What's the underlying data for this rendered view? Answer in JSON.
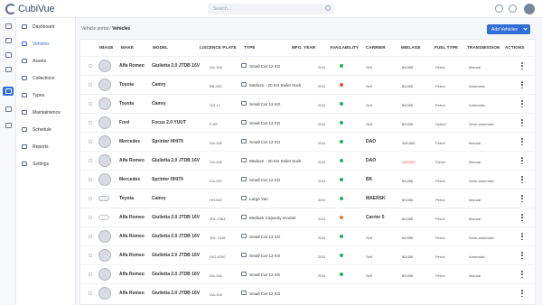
{
  "app": {
    "name": "CubiVue"
  },
  "search": {
    "placeholder": "Search..."
  },
  "breadcrumb": {
    "parent": "Vehicle portal",
    "separator": " / ",
    "current": "Vehicles"
  },
  "actions": {
    "add_label": "Add Vehicles"
  },
  "nav": [
    {
      "label": "Dashboard",
      "icon": "dashboard-icon",
      "active": false
    },
    {
      "label": "Vehicles",
      "icon": "car-icon",
      "active": true
    },
    {
      "label": "Assets",
      "icon": "assets-icon",
      "active": false
    },
    {
      "label": "Collections",
      "icon": "collections-icon",
      "active": false
    },
    {
      "label": "Types",
      "icon": "types-icon",
      "active": false
    },
    {
      "label": "Maintainience",
      "icon": "wrench-icon",
      "active": false
    },
    {
      "label": "Schedule",
      "icon": "calendar-icon",
      "active": false
    },
    {
      "label": "Reports",
      "icon": "reports-icon",
      "active": false
    },
    {
      "label": "Settings",
      "icon": "gear-icon",
      "active": false
    }
  ],
  "columns": [
    "IMAGE",
    "MAKE",
    "MODEL",
    "LISCENCE PLATE",
    "TYPE",
    "MFG. YEAR",
    "AVAILABILITY",
    "CARRIER",
    "MIELAGE",
    "FUEL TYPE",
    "TRANSMISSION",
    "ACTIONS"
  ],
  "colors": {
    "accent": "#2f6fd6",
    "available": "#27ae60",
    "unavailable": "#e74c3c",
    "warning": "#e67e22",
    "mileage_alert": "#e74c3c"
  },
  "rows": [
    {
      "image": "car",
      "make": "Alfa Romeo",
      "model": "Giulietta 2.0 JTDB 16V",
      "plate": "GA-154",
      "type": "Small Car 12 KG",
      "year": "2011",
      "availability": "available",
      "carrier": "Self",
      "carrier_bold": false,
      "mileage": "60,000",
      "mileage_alert": false,
      "fuel": "Petrol",
      "transmission": "Manual"
    },
    {
      "image": "car",
      "make": "Toyota",
      "model": "Camry",
      "plate": "BB-003",
      "type": "Medium - 20 KG trailer truck",
      "year": "2011",
      "availability": "unavailable",
      "carrier": "Self",
      "carrier_bold": false,
      "mileage": "60,000",
      "mileage_alert": false,
      "fuel": "Petrol",
      "transmission": "Automatic"
    },
    {
      "image": "car",
      "make": "Toyota",
      "model": "Camry",
      "plate": "GG-17",
      "type": "Small Car 12 KG",
      "year": "2011",
      "availability": "available",
      "carrier": "Self",
      "carrier_bold": false,
      "mileage": "60,000",
      "mileage_alert": false,
      "fuel": "Petrol",
      "transmission": "Automatic"
    },
    {
      "image": "car",
      "make": "Ford",
      "model": "Focus 2.0 YUUT",
      "plate": "P-65",
      "type": "Small Car 12 KG",
      "year": "2011",
      "availability": "available",
      "carrier": "Self",
      "carrier_bold": false,
      "mileage": "60,000",
      "mileage_alert": false,
      "fuel": "Hybrid",
      "transmission": "Semi-automatic"
    },
    {
      "image": "car",
      "make": "Mercedes",
      "model": "Sprinter HHI79",
      "plate": "GA-155",
      "type": "Small Car 12 KG",
      "year": "2011",
      "availability": "available",
      "carrier": "DAO",
      "carrier_bold": true,
      "mileage": "100,000",
      "mileage_alert": false,
      "fuel": "Petrol",
      "transmission": "Manual"
    },
    {
      "image": "car",
      "make": "Alfa Romeo",
      "model": "Giulietta 2.0 JTDB 16V",
      "plate": "GA-156",
      "type": "Medium - 20 KG trailer truck",
      "year": "2011",
      "availability": "available",
      "carrier": "DAO",
      "carrier_bold": true,
      "mileage": "150,000",
      "mileage_alert": true,
      "fuel": "Diesel",
      "transmission": "Manual"
    },
    {
      "image": "car",
      "make": "Mercedes",
      "model": "Sprinter HHI79",
      "plate": "GA-157",
      "type": "Small Car 12 KG",
      "year": "2011",
      "availability": "available",
      "carrier": "BK",
      "carrier_bold": true,
      "mileage": "60,000",
      "mileage_alert": false,
      "fuel": "Petrol",
      "transmission": "Semi-automatic"
    },
    {
      "image": "van",
      "make": "Toyota",
      "model": "Camry",
      "plate": "HH-942",
      "type": "Large Van",
      "year": "2011",
      "availability": "available",
      "carrier": "MAERSK",
      "carrier_bold": true,
      "mileage": "60,000",
      "mileage_alert": false,
      "fuel": "Petrol",
      "transmission": "Manual"
    },
    {
      "image": "bike",
      "make": "Alfa Romeo",
      "model": "Giulietta 2.0 JTDB 16V",
      "plate": "JRL-7384",
      "type": "Medium Capacity scooter",
      "year": "2011",
      "availability": "warning",
      "carrier": "Carrier 5",
      "carrier_bold": true,
      "mileage": "60,000",
      "mileage_alert": false,
      "fuel": "Petrol",
      "transmission": "Manual"
    },
    {
      "image": "car",
      "make": "Alfa Romeo",
      "model": "Giulietta 2.0 JTDB 16V",
      "plate": "JRL-7345",
      "type": "Small Car 12 KG",
      "year": "2011",
      "availability": "available",
      "carrier": "Self",
      "carrier_bold": false,
      "mileage": "60,000",
      "mileage_alert": false,
      "fuel": "Petrol",
      "transmission": "Semi-automatic"
    },
    {
      "image": "car",
      "make": "Alfa Romeo",
      "model": "Giulietta 2.0 JTDB 16V",
      "plate": "GIO-8760",
      "type": "Small Car 12 KG",
      "year": "2011",
      "availability": "available",
      "carrier": "Self",
      "carrier_bold": false,
      "mileage": "60,000",
      "mileage_alert": false,
      "fuel": "Petrol",
      "transmission": "Automatic"
    },
    {
      "image": "car",
      "make": "Alfa Romeo",
      "model": "Giulietta 2.0 JTDB 16V",
      "plate": "GA-154",
      "type": "Small Car 12 KG",
      "year": "2011",
      "availability": "available",
      "carrier": "Self",
      "carrier_bold": false,
      "mileage": "60,000",
      "mileage_alert": false,
      "fuel": "Petrol",
      "transmission": "Manual"
    },
    {
      "image": "car",
      "make": "Alfa Romeo",
      "model": "Giulietta 2.0 JTDB 16V",
      "plate": "GA-154",
      "type": "Small Car 12 KG",
      "year": "",
      "availability": "",
      "carrier": "",
      "carrier_bold": false,
      "mileage": "",
      "mileage_alert": false,
      "fuel": "",
      "transmission": ""
    }
  ]
}
